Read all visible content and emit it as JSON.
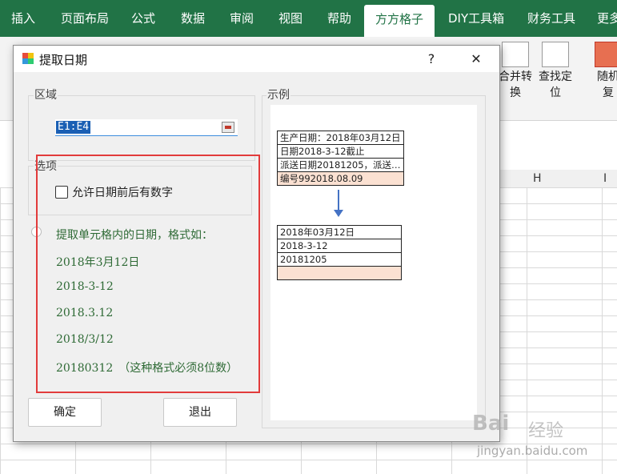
{
  "ribbon": {
    "tabs": [
      {
        "label": "插入"
      },
      {
        "label": "页面布局"
      },
      {
        "label": "公式"
      },
      {
        "label": "数据"
      },
      {
        "label": "审阅"
      },
      {
        "label": "视图"
      },
      {
        "label": "帮助"
      },
      {
        "label": "方方格子"
      },
      {
        "label": "DIY工具箱"
      },
      {
        "label": "财务工具"
      },
      {
        "label": "更多"
      }
    ],
    "buttons": [
      {
        "line1": "合并转",
        "line2": "换"
      },
      {
        "line1": "查找定",
        "line2": "位"
      },
      {
        "line1": "随机",
        "line2": "复"
      }
    ]
  },
  "sheet": {
    "columns": [
      "H",
      "I"
    ]
  },
  "dialog": {
    "title": "提取日期",
    "help_button": "?",
    "close_button": "✕",
    "range_group_label": "区域",
    "range_value": "E1:E4",
    "options_group_label": "选项",
    "checkbox_label": "允许日期前后有数字",
    "extract_label": "提取单元格内的日期，格式如：",
    "formats": [
      "2018年3月12日",
      "2018-3-12",
      "2018.3.12",
      "2018/3/12",
      "20180312　（这种格式必须8位数）"
    ],
    "ok_button": "确定",
    "exit_button": "退出",
    "example_group_label": "示例",
    "example_input": [
      "生产日期：2018年03月12日",
      "日期2018-3-12截止",
      "派送日期20181205，派送…",
      "编号992018.08.09"
    ],
    "example_output": [
      "2018年03月12日",
      "2018-3-12",
      "20181205",
      ""
    ]
  },
  "watermark": {
    "brand": "Bai",
    "brand2": "经验",
    "url": "jingyan.baidu.com"
  }
}
